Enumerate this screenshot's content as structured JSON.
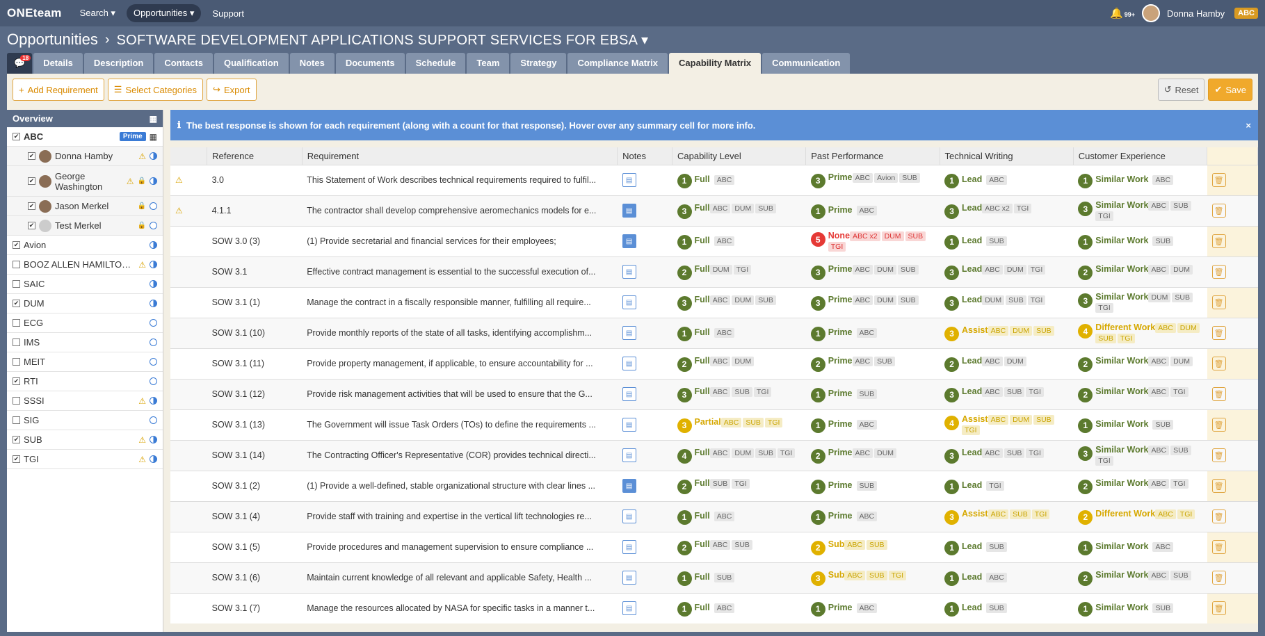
{
  "topnav": {
    "logo": "ONEteam",
    "search": "Search ▾",
    "opportunities": "Opportunities ▾",
    "support": "Support",
    "notif_count": "99+",
    "user": "Donna Hamby",
    "user_abbr": "ABC"
  },
  "breadcrumb": {
    "root": "Opportunities",
    "sep": "›",
    "project": "SOFTWARE DEVELOPMENT APPLICATIONS SUPPORT SERVICES FOR EBSA ▾"
  },
  "tabs": {
    "chat_badge": "18",
    "items": [
      "Details",
      "Description",
      "Contacts",
      "Qualification",
      "Notes",
      "Documents",
      "Schedule",
      "Team",
      "Strategy",
      "Compliance Matrix",
      "Capability Matrix",
      "Communication"
    ],
    "active": "Capability Matrix"
  },
  "toolbar": {
    "add": "Add Requirement",
    "select": "Select Categories",
    "export": "Export",
    "reset": "Reset",
    "save": "Save"
  },
  "sidebar": {
    "title": "Overview",
    "prime": "Prime",
    "rows": [
      {
        "name": "ABC",
        "checked": true,
        "bold": true
      },
      {
        "name": "Donna Hamby",
        "person": true
      },
      {
        "name": "George Washington",
        "person": true,
        "tall": true
      },
      {
        "name": "Jason Merkel",
        "person": true
      },
      {
        "name": "Test Merkel",
        "person": true
      },
      {
        "name": "Avion",
        "checked": true
      },
      {
        "name": "BOOZ ALLEN HAMILTON ...",
        "checked": false
      },
      {
        "name": "SAIC",
        "checked": false
      },
      {
        "name": "DUM",
        "checked": true
      },
      {
        "name": "ECG",
        "checked": false
      },
      {
        "name": "IMS",
        "checked": false
      },
      {
        "name": "MEIT",
        "checked": false
      },
      {
        "name": "RTI",
        "checked": true
      },
      {
        "name": "SSSI",
        "checked": false
      },
      {
        "name": "SIG",
        "checked": false
      },
      {
        "name": "SUB",
        "checked": true
      },
      {
        "name": "TGI",
        "checked": true
      }
    ]
  },
  "info": {
    "text": "The best response is shown for each requirement (along with a count for that response). Hover over any summary cell for more info.",
    "close": "×"
  },
  "table": {
    "headers": [
      "Reference",
      "Requirement",
      "Notes",
      "Capability Level",
      "Past Performance",
      "Technical Writing",
      "Customer Experience"
    ],
    "rows": [
      {
        "ref": "3.0",
        "warn": true,
        "req": "This Statement of Work describes technical requirements required to fulfil...",
        "cap": [
          "g",
          1,
          "Full",
          [
            "ABC"
          ]
        ],
        "pp": [
          "g",
          3,
          "Prime",
          [
            "ABC",
            "Avion",
            "SUB"
          ]
        ],
        "tw": [
          "g",
          1,
          "Lead",
          [
            "ABC"
          ]
        ],
        "ce": [
          "g",
          1,
          "Similar Work",
          [
            "ABC"
          ]
        ]
      },
      {
        "ref": "4.1.1",
        "warn": true,
        "note": true,
        "req": "The contractor shall develop comprehensive aeromechanics models for e...",
        "cap": [
          "g",
          3,
          "Full",
          [
            "ABC",
            "DUM",
            "SUB"
          ]
        ],
        "pp": [
          "g",
          1,
          "Prime",
          [
            "ABC"
          ]
        ],
        "tw": [
          "g",
          3,
          "Lead",
          [
            "ABC x2",
            "TGI"
          ]
        ],
        "ce": [
          "g",
          3,
          "Similar Work",
          [
            "ABC",
            "SUB",
            "TGI"
          ]
        ]
      },
      {
        "ref": "SOW 3.0 (3)",
        "note": true,
        "req": "(1) Provide secretarial and financial services for their employees;",
        "cap": [
          "g",
          1,
          "Full",
          [
            "ABC"
          ]
        ],
        "pp": [
          "r",
          5,
          "None",
          [
            "ABC x2",
            "DUM",
            "SUB",
            "TGI"
          ]
        ],
        "tw": [
          "g",
          1,
          "Lead",
          [
            "SUB"
          ]
        ],
        "ce": [
          "g",
          1,
          "Similar Work",
          [
            "SUB"
          ]
        ]
      },
      {
        "ref": "SOW 3.1",
        "req": "Effective contract management is essential to the successful execution of...",
        "cap": [
          "g",
          2,
          "Full",
          [
            "DUM",
            "TGI"
          ]
        ],
        "pp": [
          "g",
          3,
          "Prime",
          [
            "ABC",
            "DUM",
            "SUB"
          ]
        ],
        "tw": [
          "g",
          3,
          "Lead",
          [
            "ABC",
            "DUM",
            "TGI"
          ]
        ],
        "ce": [
          "g",
          2,
          "Similar Work",
          [
            "ABC",
            "DUM"
          ]
        ]
      },
      {
        "ref": "SOW 3.1 (1)",
        "req": "Manage the contract in a fiscally responsible manner, fulfilling all require...",
        "cap": [
          "g",
          3,
          "Full",
          [
            "ABC",
            "DUM",
            "SUB"
          ]
        ],
        "pp": [
          "g",
          3,
          "Prime",
          [
            "ABC",
            "DUM",
            "SUB"
          ]
        ],
        "tw": [
          "g",
          3,
          "Lead",
          [
            "DUM",
            "SUB",
            "TGI"
          ]
        ],
        "ce": [
          "g",
          3,
          "Similar Work",
          [
            "DUM",
            "SUB",
            "TGI"
          ]
        ]
      },
      {
        "ref": "SOW 3.1 (10)",
        "req": "Provide monthly reports of the state of all tasks, identifying accomplishm...",
        "cap": [
          "g",
          1,
          "Full",
          [
            "ABC"
          ]
        ],
        "pp": [
          "g",
          1,
          "Prime",
          [
            "ABC"
          ]
        ],
        "tw": [
          "y",
          3,
          "Assist",
          [
            "ABC",
            "DUM",
            "SUB"
          ]
        ],
        "ce": [
          "y",
          4,
          "Different Work",
          [
            "ABC",
            "DUM",
            "SUB",
            "TGI"
          ]
        ]
      },
      {
        "ref": "SOW 3.1 (11)",
        "req": "Provide property management, if applicable, to ensure accountability for ...",
        "cap": [
          "g",
          2,
          "Full",
          [
            "ABC",
            "DUM"
          ]
        ],
        "pp": [
          "g",
          2,
          "Prime",
          [
            "ABC",
            "SUB"
          ]
        ],
        "tw": [
          "g",
          2,
          "Lead",
          [
            "ABC",
            "DUM"
          ]
        ],
        "ce": [
          "g",
          2,
          "Similar Work",
          [
            "ABC",
            "DUM"
          ]
        ]
      },
      {
        "ref": "SOW 3.1 (12)",
        "req": "Provide risk management activities that will be used to ensure that the G...",
        "cap": [
          "g",
          3,
          "Full",
          [
            "ABC",
            "SUB",
            "TGI"
          ]
        ],
        "pp": [
          "g",
          1,
          "Prime",
          [
            "SUB"
          ]
        ],
        "tw": [
          "g",
          3,
          "Lead",
          [
            "ABC",
            "SUB",
            "TGI"
          ]
        ],
        "ce": [
          "g",
          2,
          "Similar Work",
          [
            "ABC",
            "TGI"
          ]
        ]
      },
      {
        "ref": "SOW 3.1 (13)",
        "req": "The Government will issue Task Orders (TOs) to define the requirements ...",
        "cap": [
          "y",
          3,
          "Partial",
          [
            "ABC",
            "SUB",
            "TGI"
          ]
        ],
        "pp": [
          "g",
          1,
          "Prime",
          [
            "ABC"
          ]
        ],
        "tw": [
          "y",
          4,
          "Assist",
          [
            "ABC",
            "DUM",
            "SUB",
            "TGI"
          ]
        ],
        "ce": [
          "g",
          1,
          "Similar Work",
          [
            "SUB"
          ]
        ]
      },
      {
        "ref": "SOW 3.1 (14)",
        "req": "The Contracting Officer's Representative (COR) provides technical directi...",
        "cap": [
          "g",
          4,
          "Full",
          [
            "ABC",
            "DUM",
            "SUB",
            "TGI"
          ]
        ],
        "pp": [
          "g",
          2,
          "Prime",
          [
            "ABC",
            "DUM"
          ]
        ],
        "tw": [
          "g",
          3,
          "Lead",
          [
            "ABC",
            "SUB",
            "TGI"
          ]
        ],
        "ce": [
          "g",
          3,
          "Similar Work",
          [
            "ABC",
            "SUB",
            "TGI"
          ]
        ]
      },
      {
        "ref": "SOW 3.1 (2)",
        "note": true,
        "req": "(1) Provide a well-defined, stable organizational structure with clear lines ...",
        "cap": [
          "g",
          2,
          "Full",
          [
            "SUB",
            "TGI"
          ]
        ],
        "pp": [
          "g",
          1,
          "Prime",
          [
            "SUB"
          ]
        ],
        "tw": [
          "g",
          1,
          "Lead",
          [
            "TGI"
          ]
        ],
        "ce": [
          "g",
          2,
          "Similar Work",
          [
            "ABC",
            "TGI"
          ]
        ]
      },
      {
        "ref": "SOW 3.1 (4)",
        "req": "Provide staff with training and expertise in the vertical lift technologies re...",
        "cap": [
          "g",
          1,
          "Full",
          [
            "ABC"
          ]
        ],
        "pp": [
          "g",
          1,
          "Prime",
          [
            "ABC"
          ]
        ],
        "tw": [
          "y",
          3,
          "Assist",
          [
            "ABC",
            "SUB",
            "TGI"
          ]
        ],
        "ce": [
          "y",
          2,
          "Different Work",
          [
            "ABC",
            "TGI"
          ]
        ]
      },
      {
        "ref": "SOW 3.1 (5)",
        "req": "Provide procedures and management supervision to ensure compliance ...",
        "cap": [
          "g",
          2,
          "Full",
          [
            "ABC",
            "SUB"
          ]
        ],
        "pp": [
          "y",
          2,
          "Sub",
          [
            "ABC",
            "SUB"
          ]
        ],
        "tw": [
          "g",
          1,
          "Lead",
          [
            "SUB"
          ]
        ],
        "ce": [
          "g",
          1,
          "Similar Work",
          [
            "ABC"
          ]
        ]
      },
      {
        "ref": "SOW 3.1 (6)",
        "req": "Maintain current knowledge of all relevant and applicable Safety, Health ...",
        "cap": [
          "g",
          1,
          "Full",
          [
            "SUB"
          ]
        ],
        "pp": [
          "y",
          3,
          "Sub",
          [
            "ABC",
            "SUB",
            "TGI"
          ]
        ],
        "tw": [
          "g",
          1,
          "Lead",
          [
            "ABC"
          ]
        ],
        "ce": [
          "g",
          2,
          "Similar Work",
          [
            "ABC",
            "SUB"
          ]
        ]
      },
      {
        "ref": "SOW 3.1 (7)",
        "req": "Manage the resources allocated by NASA for specific tasks in a manner t...",
        "cap": [
          "g",
          1,
          "Full",
          [
            "ABC"
          ]
        ],
        "pp": [
          "g",
          1,
          "Prime",
          [
            "ABC"
          ]
        ],
        "tw": [
          "g",
          1,
          "Lead",
          [
            "SUB"
          ]
        ],
        "ce": [
          "g",
          1,
          "Similar Work",
          [
            "SUB"
          ]
        ]
      }
    ]
  }
}
